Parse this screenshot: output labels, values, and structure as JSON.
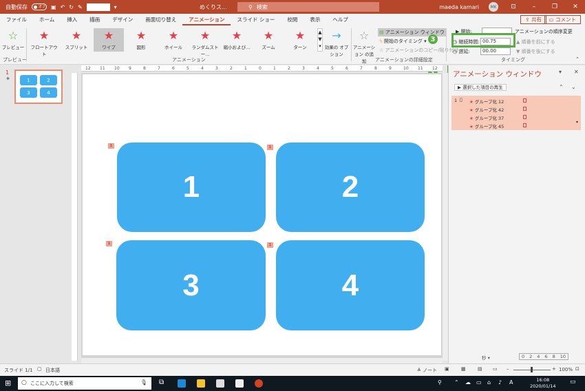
{
  "titlebar": {
    "autosave_label": "自動保存",
    "autosave_state": "オフ",
    "doc_title": "めくりス...",
    "search_placeholder": "検索",
    "user_name": "maeda kamari",
    "user_initials": "MK"
  },
  "tabs": [
    "ファイル",
    "ホーム",
    "挿入",
    "描画",
    "デザイン",
    "画面切り替え",
    "アニメーション",
    "スライド ショー",
    "校閲",
    "表示",
    "ヘルプ"
  ],
  "active_tab": "アニメーション",
  "share_label": "共有",
  "comment_label": "コメント",
  "ribbon": {
    "preview_label": "プレビュー",
    "preview_group": "プレビュー",
    "animations": [
      "フロートアウト",
      "スプリット",
      "ワイプ",
      "図形",
      "ホイール",
      "ランダムストー...",
      "縮小および...",
      "ズーム",
      "ターン"
    ],
    "selected_animation": "ワイプ",
    "animation_group": "アニメーション",
    "effect_options": "効果の オプション",
    "add_animation": "アニメーション の追加",
    "animation_pane_btn": "アニメーション ウィンドウ",
    "trigger": "開始のタイミング",
    "animation_painter": "アニメーションのコピー/貼り付け",
    "advanced_group": "アニメーションの詳細設定",
    "start_label": "開始:",
    "duration_label": "継続時間:",
    "duration_value": "00.75",
    "delay_label": "遅延:",
    "delay_value": "00.00",
    "reorder_label": "アニメーションの順序変更",
    "move_earlier": "順番を前にする",
    "move_later": "順番を後にする",
    "timing_group": "タイミング"
  },
  "badges": [
    "1",
    "2",
    "3"
  ],
  "slide_number": "1",
  "thumb_blocks": [
    "1",
    "2",
    "3",
    "4"
  ],
  "slide_blocks": [
    "1",
    "2",
    "3",
    "4"
  ],
  "anim_tags": [
    "1",
    "1",
    "1",
    "1"
  ],
  "ruler_ticks": [
    "12",
    "11",
    "10",
    "9",
    "8",
    "7",
    "6",
    "5",
    "4",
    "3",
    "2",
    "1",
    "0",
    "1",
    "2",
    "3",
    "4",
    "5",
    "6",
    "7",
    "8",
    "9",
    "10",
    "11",
    "12"
  ],
  "anim_pane": {
    "title": "アニメーション ウィンドウ",
    "play_label": "選択した項目の再生",
    "group_index": "1",
    "items": [
      "グループ化 12",
      "グループ化 42",
      "グループ化 37",
      "グループ化 45"
    ],
    "seconds_label": "秒",
    "timeline": [
      "0",
      "2",
      "4",
      "6",
      "8",
      "10"
    ]
  },
  "statusbar": {
    "slide_info": "スライド 1/1",
    "language": "日本語",
    "notes": "ノート",
    "zoom": "100%"
  },
  "taskbar": {
    "search_placeholder": "ここに入力して検索",
    "time": "16:08",
    "date": "2020/01/14",
    "ime": "A"
  }
}
